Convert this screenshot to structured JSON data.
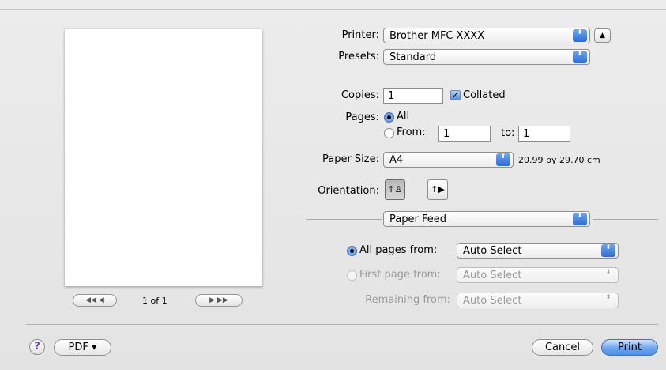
{
  "printer": {
    "label": "Printer:",
    "value": "Brother MFC-XXXX",
    "stepper_icon": "⬍",
    "up_icon": "▲"
  },
  "presets": {
    "label": "Presets:",
    "value": "Standard"
  },
  "copies": {
    "label": "Copies:",
    "value": "1",
    "collated_label": "Collated",
    "check_mark": "✓"
  },
  "pages": {
    "label": "Pages:",
    "all_label": "All",
    "from_label": "From:",
    "from_value": "1",
    "to_label": "to:",
    "to_value": "1"
  },
  "paper_size": {
    "label": "Paper Size:",
    "value": "A4",
    "dimensions": "20.99 by 29.70 cm"
  },
  "orientation": {
    "label": "Orientation:",
    "portrait_icon": "↑♙",
    "landscape_icon": "↑▶"
  },
  "section": {
    "value": "Paper Feed"
  },
  "paper_feed": {
    "all_pages_label": "All pages from:",
    "all_pages_value": "Auto Select",
    "first_page_label": "First page from:",
    "first_page_value": "Auto Select",
    "remaining_label": "Remaining from:",
    "remaining_value": "Auto Select"
  },
  "preview_nav": {
    "first_icon": "◀◀",
    "prev_icon": "◀",
    "page_indicator": "1 of 1",
    "next_icon": "▶",
    "last_icon": "▶▶"
  },
  "footer": {
    "help": "?",
    "pdf_label": "PDF ▾",
    "cancel_label": "Cancel",
    "print_label": "Print"
  }
}
